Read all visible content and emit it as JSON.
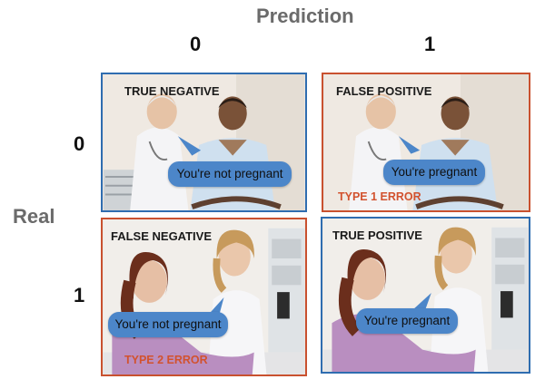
{
  "axes": {
    "prediction_title": "Prediction",
    "real_title": "Real",
    "prediction_ticks": [
      "0",
      "1"
    ],
    "real_ticks": [
      "0",
      "1"
    ]
  },
  "cells": {
    "true_negative": {
      "label": "TRUE NEGATIVE",
      "speech": "You're not pregnant"
    },
    "false_positive": {
      "label": "FALSE POSITIVE",
      "speech": "You're pregnant",
      "error": "TYPE 1 ERROR"
    },
    "false_negative": {
      "label": "FALSE NEGATIVE",
      "speech": "You're not pregnant",
      "error": "TYPE 2 ERROR"
    },
    "true_positive": {
      "label": "TRUE POSITIVE",
      "speech": "You're pregnant"
    }
  },
  "colors": {
    "correct_border": "#2f6db0",
    "error_border": "#c9512f",
    "bubble": "#4c86c9",
    "error_text": "#d2522e",
    "axis_title": "#6b6b6b"
  }
}
